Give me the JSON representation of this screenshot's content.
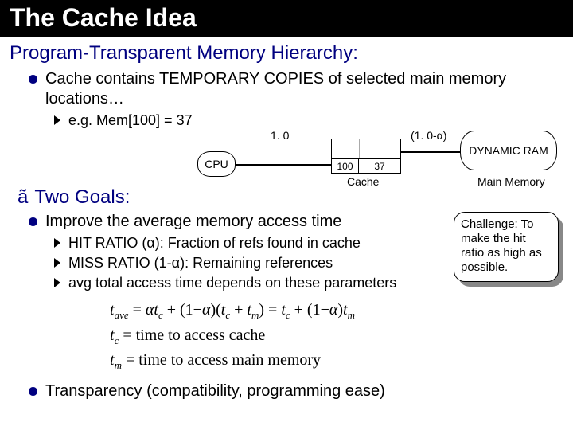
{
  "title": "The Cache Idea",
  "subtitle": "Program-Transparent Memory Hierarchy:",
  "bullet1": "Cache contains TEMPORARY COPIES of selected main memory locations…",
  "example": "e.g. Mem[100] =  37",
  "diagram": {
    "cpu": "CPU",
    "prob_hit": "1. 0",
    "prob_miss": "(1. 0-α)",
    "cache_tag": "100",
    "cache_data": "37",
    "cache_label": "Cache",
    "dram": "DYNAMIC RAM",
    "mm_label": "Main Memory"
  },
  "two_goals": "Two Goals:",
  "goal1": "Improve the average memory access time",
  "goal1_subs": {
    "hit": "HIT RATIO (α):  Fraction of refs found in cache",
    "miss": "MISS RATIO (1-α):  Remaining references",
    "avg": "avg total access time depends on these parameters"
  },
  "challenge": {
    "title": "Challenge:",
    "body": "To make the hit ratio as high as possible."
  },
  "formula": {
    "line1_lhs": "t",
    "line1_sub": "ave",
    "line1_rhs": " = αt_c + (1−α)(t_c + t_m) = t_c + (1−α)t_m",
    "line2": "t_c = time to access cache",
    "line3": "t_m = time to access main memory"
  },
  "goal2": "Transparency (compatibility, programming ease)"
}
